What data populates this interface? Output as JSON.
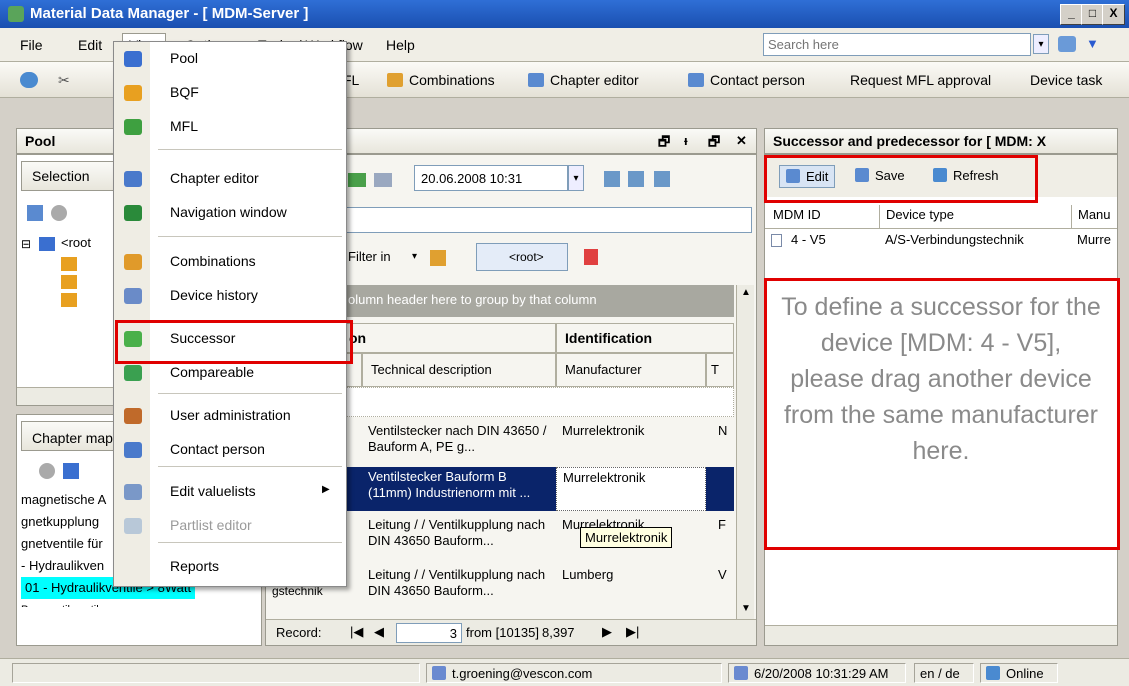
{
  "window": {
    "title": "Material Data Manager  -  [ MDM-Server ]",
    "minimize": "_",
    "maximize": "□",
    "close": "X"
  },
  "menubar": {
    "items": [
      "File",
      "Edit",
      "View",
      "Options",
      "Tasks / Workflow",
      "Help"
    ],
    "search_placeholder": "Search here"
  },
  "toolbar": {
    "items": [
      "FL",
      "Combinations",
      "Chapter editor",
      "Contact person",
      "Request MFL approval",
      "Device task"
    ]
  },
  "view_menu": {
    "items": [
      {
        "label": "Pool",
        "icon": "pool-icon",
        "color": "#3a6fd0"
      },
      {
        "label": "BQF",
        "icon": "bqf-icon",
        "color": "#e8a020"
      },
      {
        "label": "MFL",
        "icon": "mfl-icon",
        "color": "#3ea040"
      },
      {
        "label": "Chapter editor",
        "icon": "chapter-editor-icon",
        "color": "#4a7acb"
      },
      {
        "label": "Navigation window",
        "icon": "navigation-icon",
        "color": "#2a8a3a"
      },
      {
        "label": "Combinations",
        "icon": "combinations-icon",
        "color": "#e09a2a"
      },
      {
        "label": "Device history",
        "icon": "history-icon",
        "color": "#6a8bc8"
      },
      {
        "label": "Successor",
        "icon": "successor-arrow-icon",
        "color": "#4ab04a"
      },
      {
        "label": "Compareable",
        "icon": "compare-icon",
        "color": "#3aa050"
      },
      {
        "label": "User administration",
        "icon": "users-icon",
        "color": "#c06a2a"
      },
      {
        "label": "Contact person",
        "icon": "contact-icon",
        "color": "#4a7acb"
      },
      {
        "label": "Edit valuelists",
        "icon": "valuelist-icon",
        "color": "#7a98c8",
        "arrow": "▶"
      },
      {
        "label": "Partlist editor",
        "icon": "partlist-icon",
        "color": "#b8c8d8",
        "disabled": true
      },
      {
        "label": "Reports",
        "icon": "reports-icon",
        "color": ""
      }
    ]
  },
  "pool": {
    "title": "Pool",
    "selection_title": "Selection",
    "tree_root": "<root",
    "chapter_title": "Chapter map",
    "chapter_items": [
      "magnetische A",
      "gnetkupplung",
      "gnetventile für",
      "- Hydraulikven"
    ],
    "chapter_highlight": "01 - Hydraulikventile > 8Watt",
    "chapter_last": "Pneumatikventile"
  },
  "center": {
    "date": "20.06.2008 10:31",
    "filter_label": "Filter in",
    "root_tag": "<root>",
    "group_hint": "olumn header here to group by that column",
    "group_headers": [
      "on",
      "Identification"
    ],
    "columns": [
      "Technical description",
      "Manufacturer"
    ],
    "rows": [
      {
        "left": "",
        "desc": "Ventilstecker nach DIN 43650 / Bauform A, PE g...",
        "mfr": "Murrelektronik",
        "extra": "N"
      },
      {
        "left": "",
        "desc": "Ventilstecker Bauform B (11mm) Industrienorm mit ...",
        "mfr": "Murrelektronik",
        "extra": "",
        "selected": true
      },
      {
        "left": "",
        "desc": "Leitung /  / Ventilkupplung nach DIN 43650 Bauform...",
        "mfr": "Murrelektronik",
        "extra": "F",
        "tooltip": true
      },
      {
        "left": "S-Verbind gstechnik",
        "desc": "Leitung /  / Ventilkupplung nach DIN 43650 Bauform...",
        "mfr": "Lumberg",
        "extra": "V"
      }
    ],
    "record_label": "Record:",
    "record_current": "3",
    "record_total": "from [10135]",
    "record_id": "8,397"
  },
  "right": {
    "title": "Successor and predecessor for [ MDM: X",
    "buttons": [
      "Edit",
      "Save",
      "Refresh"
    ],
    "columns": [
      "MDM ID",
      "Device type",
      "Manu"
    ],
    "row": {
      "id": "4 - V5",
      "type": "A/S-Verbindungstechnik",
      "manu": "Murre"
    },
    "callout": "To define a successor for the device [MDM: 4 - V5], please drag another device from the same manufacturer here."
  },
  "status": {
    "user": "t.groening@vescon.com",
    "datetime": "6/20/2008 10:31:29 AM",
    "lang": "en / de",
    "online": "Online"
  },
  "colors": {
    "highlight": "#e00000",
    "selected_row": "#0a246a",
    "chapter_highlight": "#00ffff",
    "callout_text": "#8a8a8a"
  }
}
